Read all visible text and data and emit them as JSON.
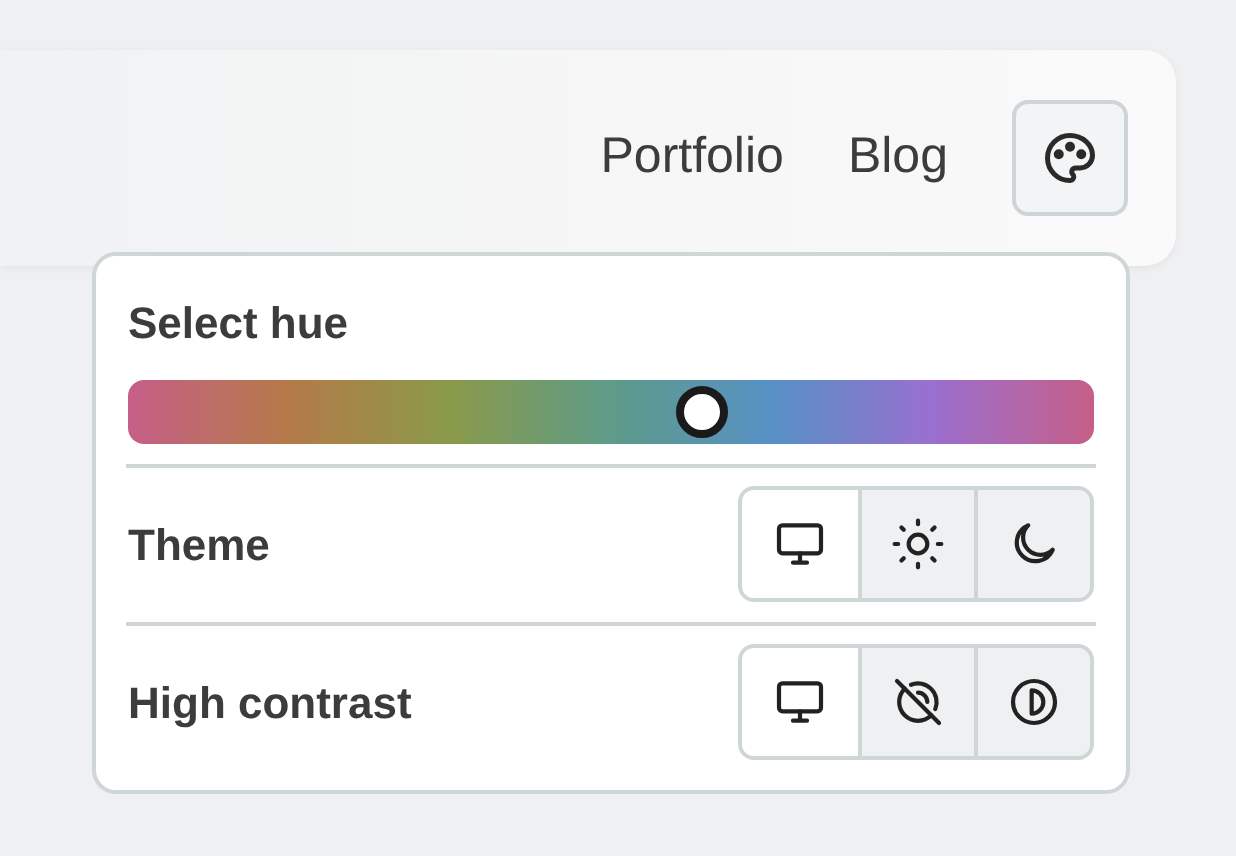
{
  "nav_links": [
    {
      "label": "Portfolio"
    },
    {
      "label": "Blog"
    }
  ],
  "popover": {
    "hue": {
      "label": "Select hue",
      "level": 0.595
    },
    "settings": [
      {
        "label": "Theme",
        "options": [
          {
            "kind": "monitor",
            "selected": true
          },
          {
            "kind": "sun",
            "selected": false
          },
          {
            "kind": "moon",
            "selected": false
          }
        ]
      },
      {
        "label": "High contrast",
        "options": [
          {
            "kind": "monitor",
            "selected": true
          },
          {
            "kind": "contrastoff",
            "selected": false
          },
          {
            "kind": "contrast",
            "selected": false
          }
        ]
      }
    ]
  }
}
